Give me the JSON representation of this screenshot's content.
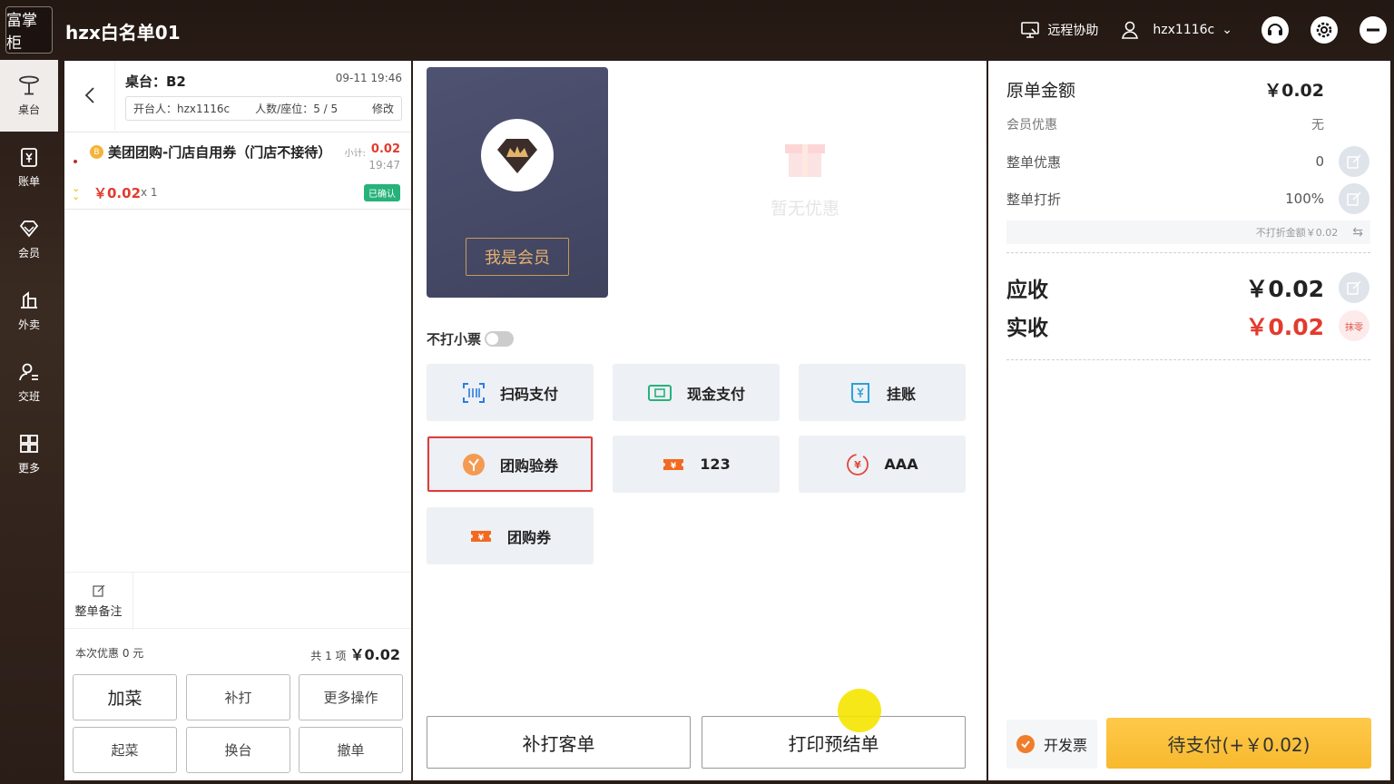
{
  "app": {
    "logo_text": "富掌柜",
    "title": "hzx白名单01"
  },
  "topbar": {
    "remote_help": "远程协助",
    "username": "hzx1116c"
  },
  "sidebar": {
    "items": [
      {
        "label": "桌台",
        "icon": "table-icon",
        "active": true
      },
      {
        "label": "账单",
        "icon": "bill-icon"
      },
      {
        "label": "会员",
        "icon": "member-icon"
      },
      {
        "label": "外卖",
        "icon": "delivery-icon"
      },
      {
        "label": "交班",
        "icon": "shift-icon"
      },
      {
        "label": "更多",
        "icon": "grid-icon"
      }
    ]
  },
  "order": {
    "table": "桌台：B2",
    "time": "09-11 19:46",
    "opener": "开台人：hzx1116c",
    "guests": "人数/座位：5 / 5",
    "modify": "修改",
    "item": {
      "coin": "B",
      "name": "美团团购-门店自用券（门店不接待）",
      "subtotal_label": "小计:",
      "subtotal": "0.02",
      "time": "19:47",
      "price": "￥0.02",
      "qty": "x 1",
      "status": "已确认"
    },
    "note_label": "整单备注",
    "discount_text": "本次优惠 0 元",
    "count_text": "共 1 项",
    "total": "￥0.02",
    "buttons": {
      "add": "加菜",
      "reprint": "补打",
      "more": "更多操作",
      "serve": "起菜",
      "change_table": "换台",
      "cancel": "撤单"
    }
  },
  "middle": {
    "member_button": "我是会员",
    "no_discount": "暂无优惠",
    "no_receipt_label": "不打小票",
    "payments": [
      {
        "label": "扫码支付",
        "icon": "scan-icon"
      },
      {
        "label": "现金支付",
        "icon": "cash-icon"
      },
      {
        "label": "挂账",
        "icon": "credit-icon"
      },
      {
        "label": "团购验券",
        "icon": "groupbuy-verify-icon",
        "highlighted": true
      },
      {
        "label": "123",
        "icon": "ticket-icon"
      },
      {
        "label": "AAA",
        "icon": "yen-circle-icon"
      },
      {
        "label": "团购券",
        "icon": "ticket-icon"
      }
    ],
    "reprint_guest": "补打客单",
    "print_prebill": "打印预结单"
  },
  "summary": {
    "original_label": "原单金额",
    "original_value": "￥0.02",
    "member_discount_label": "会员优惠",
    "member_discount_value": "无",
    "order_discount_label": "整单优惠",
    "order_discount_value": "0",
    "order_rate_label": "整单打折",
    "order_rate_value": "100%",
    "nodiscount_amount": "不打折金额￥0.02",
    "receivable_label": "应收",
    "receivable_value": "￥0.02",
    "paid_label": "实收",
    "paid_value": "￥0.02",
    "round_off": "抹零",
    "invoice_label": "开发票",
    "pay_button": "待支付(+￥0.02)"
  },
  "colors": {
    "accent_red": "#e23b2e",
    "pay_yellow": "#f7b92e",
    "member_card": "#4a4e6c",
    "confirmed_green": "#27b27a"
  }
}
